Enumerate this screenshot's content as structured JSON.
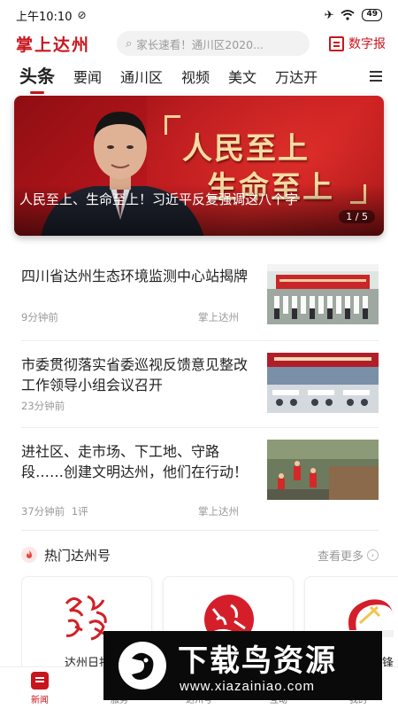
{
  "status_bar": {
    "time": "上午10:10",
    "battery": "49"
  },
  "header": {
    "logo": "掌上达州",
    "search_placeholder": "家长速看！通川区2020...",
    "digital_label": "数字报"
  },
  "tabs": [
    {
      "label": "头条",
      "active": true
    },
    {
      "label": "要闻"
    },
    {
      "label": "通川区"
    },
    {
      "label": "视频"
    },
    {
      "label": "美文"
    },
    {
      "label": "万达开"
    }
  ],
  "banner": {
    "poster_line1": "人民至上",
    "poster_line2": "生命至上",
    "caption": "人民至上、生命至上！习近平反复强调这八个字",
    "pager": "1 / 5"
  },
  "news": [
    {
      "title": "四川省达州生态环境监测中心站揭牌",
      "time": "9分钟前",
      "comments": "",
      "source": "掌上达州"
    },
    {
      "title": "市委贯彻落实省委巡视反馈意见整改工作领导小组会议召开",
      "time": "23分钟前",
      "comments": "",
      "source": ""
    },
    {
      "title": "进社区、走市场、下工地、守路段……创建文明达州，他们在行动！",
      "time": "37分钟前",
      "comments": "1评",
      "source": "掌上达州"
    }
  ],
  "hot": {
    "title": "热门达州号",
    "more": "查看更多",
    "cards": [
      {
        "name": "达州日报"
      },
      {
        "name": ""
      },
      {
        "name": "达州先锋"
      }
    ]
  },
  "bottom_nav": [
    {
      "label": "新闻",
      "active": true
    },
    {
      "label": "服务"
    },
    {
      "label": "达州号"
    },
    {
      "label": "互动"
    },
    {
      "label": "我的"
    }
  ],
  "watermark": {
    "main": "下载鸟资源",
    "url": "www.xiazainiao.com"
  },
  "colors": {
    "accent": "#c8161d",
    "banner_red": "#b5161c"
  }
}
